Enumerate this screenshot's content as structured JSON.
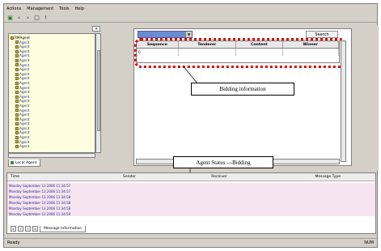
{
  "menu": [
    "Actions",
    "Management",
    "Tools",
    "Help"
  ],
  "toolbar_icons": [
    "new-icon",
    "back-icon",
    "forward-icon",
    "refresh-icon",
    "info-icon"
  ],
  "tree": {
    "root": "RMAgent",
    "items": [
      "Agent",
      "Agent",
      "Agent",
      "Agent",
      "Agent",
      "Agent",
      "Agent",
      "Agent",
      "Agent",
      "Agent",
      "Agent",
      "Agent",
      "Agent",
      "Agent",
      "Agent",
      "Agent",
      "Agent",
      "Agent",
      "Agent",
      "Agent",
      "Agent",
      "Agent",
      "Agent",
      "Agent"
    ],
    "tab_label": "Local Agent"
  },
  "main": {
    "agent_select": "",
    "search_label": "Search",
    "columns": [
      "Sequence",
      "Tenderer",
      "Content",
      "Winner"
    ],
    "rows": [
      [
        "0",
        "",
        "",
        ""
      ]
    ]
  },
  "annotations": {
    "bidding_info": "Bidding information",
    "agent_status": "Agent Status ---Bidding"
  },
  "messages": {
    "columns": [
      "Time",
      "Sender",
      "Receiver",
      "Message Type"
    ],
    "rows": [
      {
        "time": "Monday  September 13  2006 11:34:57",
        "sender": "",
        "receiver": "",
        "type": ""
      },
      {
        "time": "Monday  September 13  2006 11:34:57",
        "sender": "",
        "receiver": "",
        "type": ""
      },
      {
        "time": "Monday  September 13  2006 11:34:58",
        "sender": "",
        "receiver": "",
        "type": ""
      },
      {
        "time": "Monday  September 13  2006 11:34:58",
        "sender": "",
        "receiver": "",
        "type": ""
      },
      {
        "time": "Monday  September 13  2006 11:34:58",
        "sender": "",
        "receiver": "",
        "type": ""
      },
      {
        "time": "Monday  September 13  2006 11:34:59",
        "sender": "",
        "receiver": "",
        "type": ""
      }
    ],
    "tab_label": "Message Information"
  },
  "status": {
    "left": "Ready",
    "right": "NUM"
  },
  "colors": {
    "highlight": "#e00000",
    "window_bg": "#d4d0c8",
    "tree_bg": "#fffde0",
    "message_band": "#f7e4f1"
  }
}
